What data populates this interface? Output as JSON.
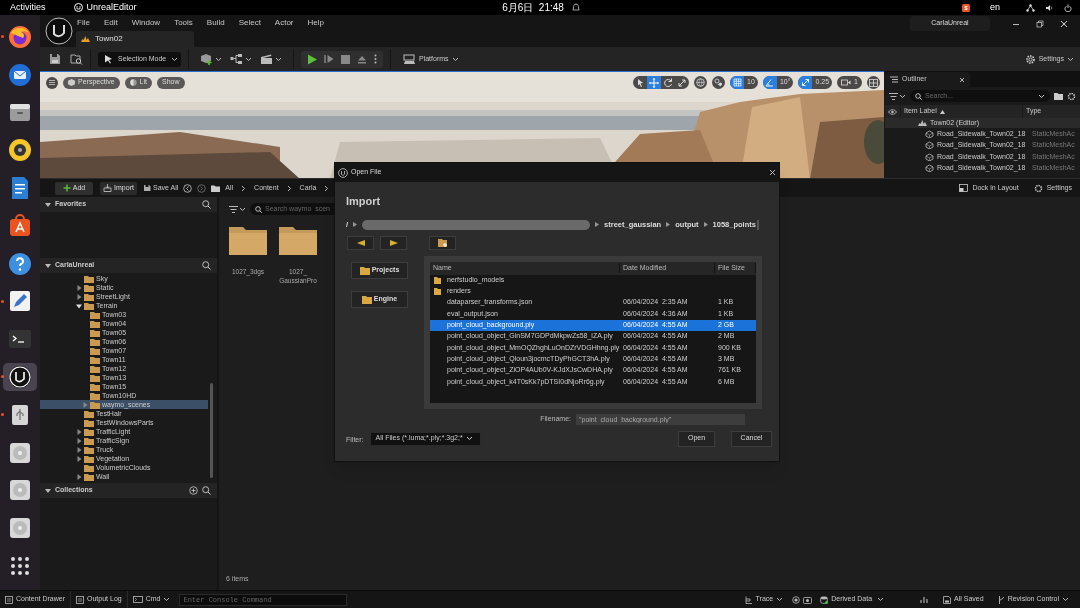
{
  "system_bar": {
    "activities": "Activities",
    "app": "UnrealEditor",
    "clock": "6月6日  21:48",
    "language": "en"
  },
  "dock": [
    {
      "kind": "firefox",
      "running": true,
      "selected": false
    },
    {
      "kind": "thunderbird",
      "running": false,
      "selected": false
    },
    {
      "kind": "files",
      "running": false,
      "selected": false
    },
    {
      "kind": "rhythmbox",
      "running": false,
      "selected": false
    },
    {
      "kind": "writer",
      "running": false,
      "selected": false
    },
    {
      "kind": "software",
      "running": false,
      "selected": false
    },
    {
      "kind": "help",
      "running": false,
      "selected": false
    },
    {
      "kind": "editor",
      "running": true,
      "selected": false
    },
    {
      "kind": "terminal",
      "running": false,
      "selected": false
    },
    {
      "kind": "unreal",
      "running": true,
      "selected": true
    },
    {
      "kind": "usb",
      "running": true,
      "selected": false
    },
    {
      "kind": "disc",
      "running": false,
      "selected": false
    },
    {
      "kind": "disc",
      "running": false,
      "selected": false
    },
    {
      "kind": "disc",
      "running": false,
      "selected": false
    },
    {
      "kind": "apps",
      "running": false,
      "selected": false
    }
  ],
  "menu": [
    "File",
    "Edit",
    "Window",
    "Tools",
    "Build",
    "Select",
    "Actor",
    "Help"
  ],
  "level_tab": "Town02",
  "project": "CarlaUnreal",
  "toolbar": {
    "selection_mode": "Selection Mode",
    "platforms": "Platforms",
    "settings": "Settings"
  },
  "viewport": {
    "buttons": [
      {
        "kind": "view",
        "label": "Perspective"
      },
      {
        "kind": "lighting",
        "label": "Lit"
      },
      {
        "kind": "show",
        "label": "Show"
      }
    ],
    "transform_tools": [
      {
        "kind": "select",
        "selected": false
      },
      {
        "kind": "move",
        "selected": true
      },
      {
        "kind": "rotate",
        "selected": false
      },
      {
        "kind": "scale",
        "selected": false
      }
    ],
    "snaps": [
      {
        "kind": "grid",
        "value": "10",
        "on": true
      },
      {
        "kind": "angle",
        "value": "10°",
        "on": true
      },
      {
        "kind": "scale",
        "value": "0.25",
        "on": true
      }
    ],
    "camera_speed": "1"
  },
  "outliner": {
    "title": "Outliner",
    "search_placeholder": "Search...",
    "columns": [
      "Item Label",
      "Type"
    ],
    "rows": [
      {
        "label": "Town02 (Editor)",
        "children": [
          {
            "label": "Road_Sidewalk_Town02_18",
            "type": "StaticMeshAc"
          },
          {
            "label": "Road_Sidewalk_Town02_18",
            "type": "StaticMeshAc"
          },
          {
            "label": "Road_Sidewalk_Town02_18",
            "type": "StaticMeshAc"
          },
          {
            "label": "Road_Sidewalk_Town02_18",
            "type": "StaticMeshAc"
          }
        ]
      }
    ]
  },
  "content_browser": {
    "add": "Add",
    "import": "Import",
    "save_all": "Save All",
    "breadcrumb": [
      "All",
      "Content",
      "Carla"
    ],
    "dock": "Dock in Layout",
    "settings": "Settings",
    "favorites": "Favorites",
    "root": "CarlaUnreal",
    "tree": [
      {
        "label": "Sky",
        "expandable": false,
        "selected": false
      },
      {
        "label": "Static",
        "expandable": true,
        "expanded": false,
        "selected": false
      },
      {
        "label": "StreetLight",
        "expandable": true,
        "expanded": false,
        "selected": false
      },
      {
        "label": "Terrain",
        "expandable": true,
        "expanded": true,
        "selected": false,
        "children": [
          {
            "label": "Town03",
            "expandable": false,
            "selected": false
          },
          {
            "label": "Town04",
            "expandable": false,
            "selected": false
          },
          {
            "label": "Town05",
            "expandable": false,
            "selected": false
          },
          {
            "label": "Town06",
            "expandable": false,
            "selected": false
          },
          {
            "label": "Town07",
            "expandable": false,
            "selected": false
          },
          {
            "label": "Town11",
            "expandable": false,
            "selected": false
          },
          {
            "label": "Town12",
            "expandable": false,
            "selected": false
          },
          {
            "label": "Town13",
            "expandable": false,
            "selected": false
          },
          {
            "label": "Town15",
            "expandable": false,
            "selected": false
          },
          {
            "label": "Town10HD",
            "expandable": false,
            "selected": false
          },
          {
            "label": "waymo_scenes",
            "expandable": true,
            "expanded": false,
            "selected": true
          }
        ]
      },
      {
        "label": "TestHair",
        "expandable": false,
        "selected": false
      },
      {
        "label": "TestWindowsParts",
        "expandable": false,
        "selected": false
      },
      {
        "label": "TrafficLight",
        "expandable": true,
        "expanded": false,
        "selected": false
      },
      {
        "label": "TrafficSign",
        "expandable": true,
        "expanded": false,
        "selected": false
      },
      {
        "label": "Truck",
        "expandable": true,
        "expanded": false,
        "selected": false
      },
      {
        "label": "Vegetation",
        "expandable": true,
        "expanded": false,
        "selected": false
      },
      {
        "label": "VolumetricClouds",
        "expandable": false,
        "selected": false
      },
      {
        "label": "Wall",
        "expandable": true,
        "expanded": false,
        "selected": false
      }
    ],
    "collections": "Collections",
    "search_placeholder": "Search waymo_scen",
    "assets": [
      "1027_3dgs",
      "1027_ GaussianPro"
    ],
    "item_count": "6 items"
  },
  "dialog": {
    "title": "Open File",
    "heading": "Import",
    "path": [
      {
        "kind": "text",
        "label": "/"
      },
      {
        "kind": "redacted"
      },
      {
        "kind": "text",
        "label": "street_gaussian"
      },
      {
        "kind": "text",
        "label": "output"
      },
      {
        "kind": "text",
        "label": "1058_points"
      }
    ],
    "places": [
      "Projects",
      "Engine"
    ],
    "columns": [
      "Name",
      "Date Modified",
      "File Size"
    ],
    "files": [
      {
        "kind": "folder",
        "name": "nerfstudio_models",
        "selected": false
      },
      {
        "kind": "folder",
        "name": "renders",
        "selected": false
      },
      {
        "kind": "file",
        "name": "dataparser_transforms.json",
        "date": "06/04/2024  2:35 AM",
        "size": "1 KB",
        "selected": false
      },
      {
        "kind": "file",
        "name": "eval_output.json",
        "date": "06/04/2024  4:36 AM",
        "size": "1 KB",
        "selected": false
      },
      {
        "kind": "file",
        "name": "point_cloud_background.ply",
        "date": "06/04/2024  4:55 AM",
        "size": "2 GB",
        "selected": true
      },
      {
        "kind": "file",
        "name": "point_cloud_object_GinSM7GDPdMkpwZs58_iZA.ply",
        "date": "06/04/2024  4:55 AM",
        "size": "2 MB",
        "selected": false
      },
      {
        "kind": "file",
        "name": "point_cloud_object_MmOQZhghLuOnDZrVDGHhng.ply",
        "date": "06/04/2024  4:55 AM",
        "size": "900 KB",
        "selected": false
      },
      {
        "kind": "file",
        "name": "point_cloud_object_Qloun3jocmcTDyPhGCT3hA.ply",
        "date": "06/04/2024  4:55 AM",
        "size": "3 MB",
        "selected": false
      },
      {
        "kind": "file",
        "name": "point_cloud_object_ZiOP4AUb0V-KJdXJsCwDHA.ply",
        "date": "06/04/2024  4:55 AM",
        "size": "761 KB",
        "selected": false
      },
      {
        "kind": "file",
        "name": "point_cloud_object_k4T0sKk7pDTSI0dNjoRr6g.ply",
        "date": "06/04/2024  4:55 AM",
        "size": "6 MB",
        "selected": false
      }
    ],
    "filename_label": "Filename:",
    "filename": "\"point_cloud_background.ply\"",
    "filter_label": "Filter:",
    "filter": "All Files (*.luma;*.ply;*.3g2;*",
    "open": "Open",
    "cancel": "Cancel"
  },
  "status_bar": {
    "content_drawer": "Content Drawer",
    "output_log": "Output Log",
    "cmd": "Cmd",
    "console_placeholder": "Enter Console Command",
    "trace": "Trace",
    "derived_data": "Derived Data",
    "saved": "All Saved",
    "revision_control": "Revision Control"
  }
}
